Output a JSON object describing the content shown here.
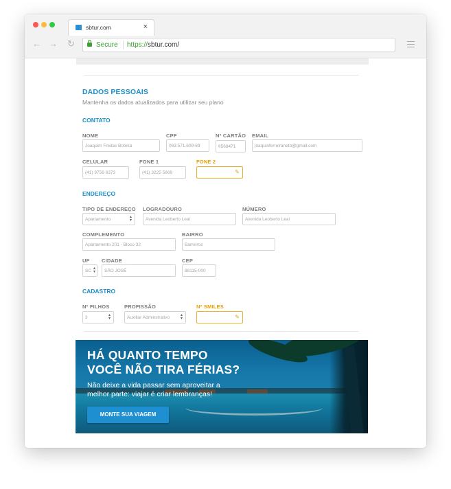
{
  "browser": {
    "tab_title": "sbtur.com",
    "tab_close": "×",
    "back": "←",
    "forward": "→",
    "reload": "↻",
    "secure_label": "Secure",
    "url_scheme": "https://",
    "url_rest": "sbtur.com/"
  },
  "form": {
    "title": "DADOS PESSOAIS",
    "subtitle": "Mantenha os dados atualizados para utilizar seu plano",
    "contato": {
      "heading": "CONTATO",
      "nome_label": "NOME",
      "nome_value": "Joaquim Freitas Boteka",
      "cpf_label": "CPF",
      "cpf_value": "063.571.609-69",
      "cartao_label": "Nº CARTÃO",
      "cartao_value": "6568471",
      "email_label": "EMAIL",
      "email_value": "joaquinferreiraneto@gmail.com",
      "celular_label": "CELULAR",
      "celular_value": "(41) 9756 6373",
      "fone1_label": "FONE 1",
      "fone1_value": "(41) 3225 5669",
      "fone2_label": "FONE 2",
      "fone2_value": ""
    },
    "endereco": {
      "heading": "ENDEREÇO",
      "tipo_label": "TIPO DE ENDEREÇO",
      "tipo_value": "Apartamento",
      "logradouro_label": "LOGRADOURO",
      "logradouro_value": "Avenida Leoberto Leal",
      "numero_label": "NÚMERO",
      "numero_value": "Avenida Leoberto Leal",
      "complemento_label": "COMPLEMENTO",
      "complemento_value": "Apartamento 201 - Bloco 32",
      "bairro_label": "BAIRRO",
      "bairro_value": "Barreiros",
      "uf_label": "UF",
      "uf_value": "SC",
      "cidade_label": "CIDADE",
      "cidade_value": "SÃO JOSÉ",
      "cep_label": "CEP",
      "cep_value": "88115-000"
    },
    "cadastro": {
      "heading": "CADASTRO",
      "filhos_label": "Nº FILHOS",
      "filhos_value": "3",
      "profissao_label": "PROFISSÃO",
      "profissao_value": "Auxiliar Adminstrativo",
      "smiles_label": "Nº SMILES",
      "smiles_value": ""
    }
  },
  "banner": {
    "title_line1": "HÁ QUANTO TEMPO",
    "title_line2": "VOCÊ NÃO TIRA FÉRIAS?",
    "text_line1": "Não deixe a vida passar sem aproveitar a",
    "text_line2": "melhor parte: viajar é criar lembranças!",
    "button_label": "MONTE SUA VIAGEM"
  },
  "colors": {
    "accent_blue": "#1b8fca",
    "accent_orange": "#e8a000",
    "button_blue": "#1e8fd1",
    "secure_green": "#3aa130"
  },
  "icons": {
    "pencil": "✎",
    "select_arrows": "▲▼"
  }
}
